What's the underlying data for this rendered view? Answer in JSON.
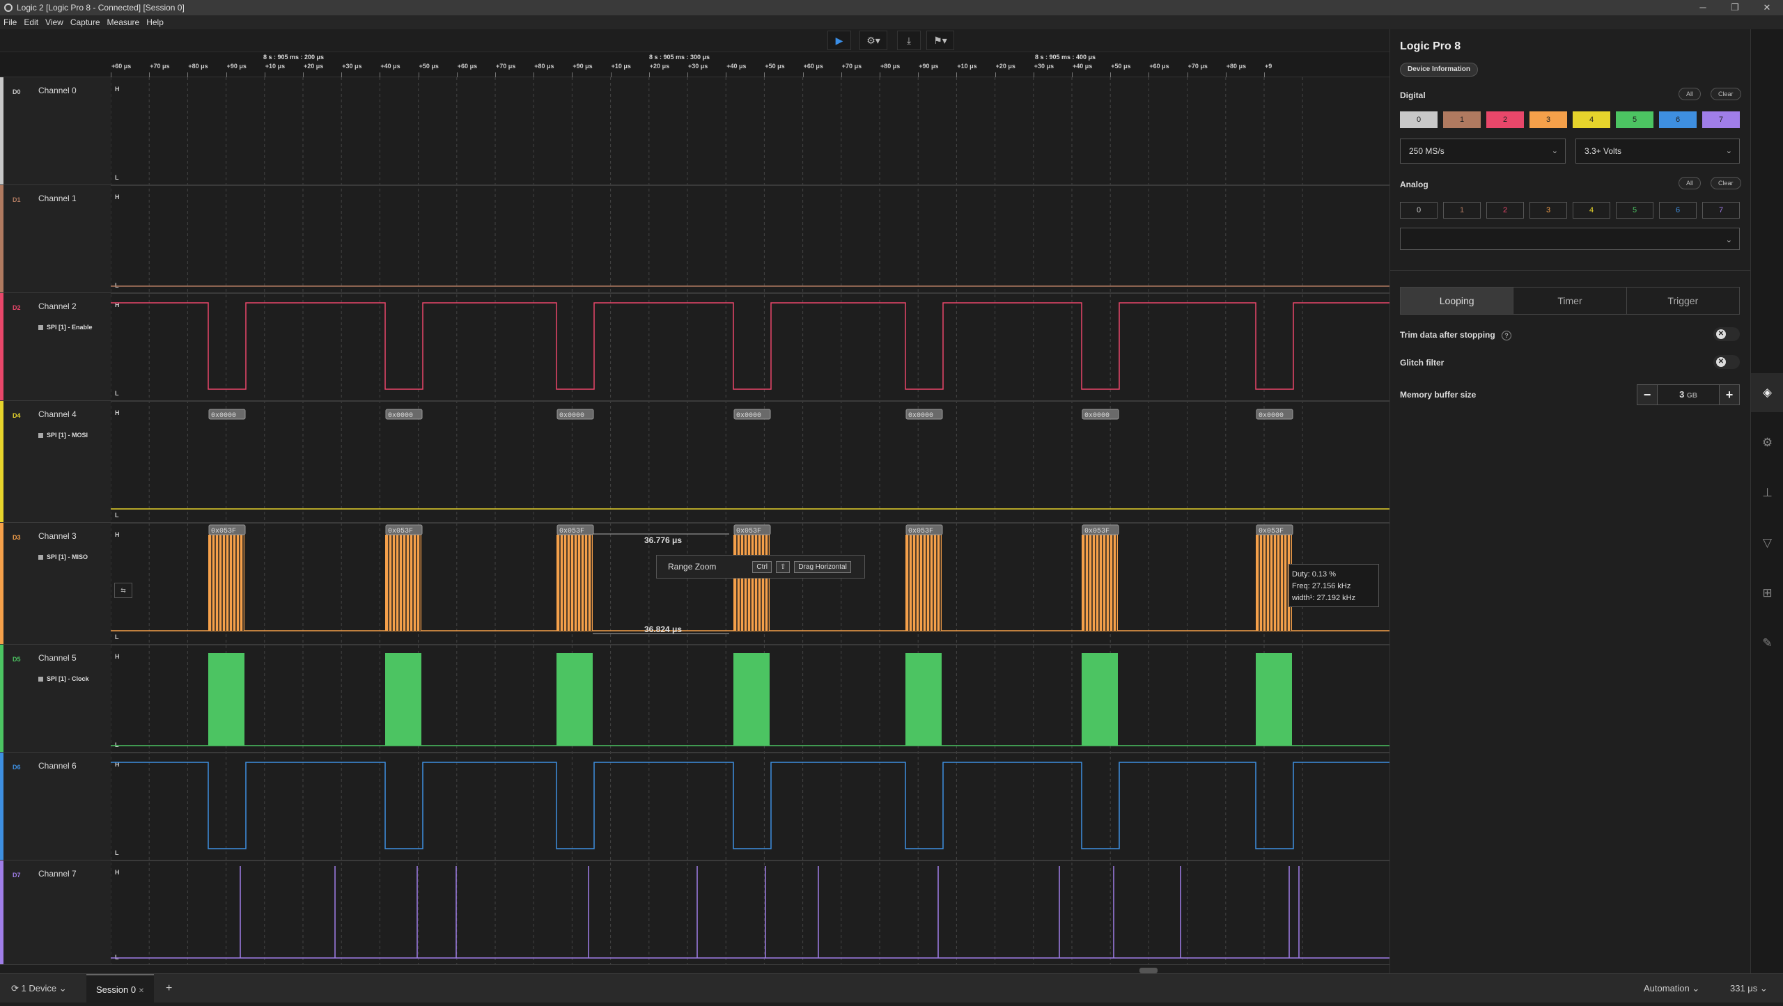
{
  "window": {
    "title": "Logic 2 [Logic Pro 8 - Connected] [Session 0]"
  },
  "menu": [
    "File",
    "Edit",
    "View",
    "Capture",
    "Measure",
    "Help"
  ],
  "ruler": {
    "markers": [
      "8 s : 905 ms : 200 μs",
      "8 s : 905 ms : 300 μs",
      "8 s : 905 ms : 400 μs"
    ],
    "ticks": [
      "+60 μs",
      "+70 μs",
      "+80 μs",
      "+90 μs",
      "+10 μs",
      "+20 μs",
      "+30 μs",
      "+40 μs",
      "+50 μs",
      "+60 μs",
      "+70 μs",
      "+80 μs",
      "+90 μs",
      "+10 μs",
      "+20 μs",
      "+30 μs",
      "+40 μs",
      "+50 μs",
      "+60 μs",
      "+70 μs",
      "+80 μs",
      "+90 μs",
      "+10 μs",
      "+20 μs",
      "+30 μs",
      "+40 μs",
      "+50 μs",
      "+60 μs",
      "+70 μs",
      "+80 μs",
      "+9"
    ]
  },
  "channels": [
    {
      "id": "D0",
      "name": "Channel 0",
      "color": "#c8c8c8",
      "protocol": ""
    },
    {
      "id": "D1",
      "name": "Channel 1",
      "color": "#b07a60",
      "protocol": ""
    },
    {
      "id": "D2",
      "name": "Channel 2",
      "color": "#e8476a",
      "protocol": "SPI [1] - Enable"
    },
    {
      "id": "D4",
      "name": "Channel 4",
      "color": "#e6d42c",
      "protocol": "SPI [1] - MOSI"
    },
    {
      "id": "D3",
      "name": "Channel 3",
      "color": "#f5a04a",
      "protocol": "SPI [1] - MISO"
    },
    {
      "id": "D5",
      "name": "Channel 5",
      "color": "#4cc462",
      "protocol": "SPI [1] - Clock"
    },
    {
      "id": "D6",
      "name": "Channel 6",
      "color": "#3e8fe0",
      "protocol": ""
    },
    {
      "id": "D7",
      "name": "Channel 7",
      "color": "#a07ee8",
      "protocol": ""
    }
  ],
  "wave_labels": {
    "high": "H",
    "low": "L"
  },
  "decoded": {
    "mosi_value": "0x0000",
    "miso_value": "0x053F"
  },
  "measurements": {
    "upper": "36.776 μs",
    "lower": "36.824 μs"
  },
  "tooltip": {
    "label": "Range Zoom",
    "key1": "Ctrl",
    "key2": "⇧",
    "action": "Drag Horizontal"
  },
  "measure_box": {
    "duty": "Duty: 0.13 %",
    "freq": "Freq: 27.156 kHz",
    "width": "width¹: 27.192 kHz"
  },
  "panel": {
    "title": "Logic Pro 8",
    "device_info": "Device Information",
    "digital_label": "Digital",
    "analog_label": "Analog",
    "all": "All",
    "clear": "Clear",
    "digital_channels": [
      "0",
      "1",
      "2",
      "3",
      "4",
      "5",
      "6",
      "7"
    ],
    "analog_channels": [
      "0",
      "1",
      "2",
      "3",
      "4",
      "5",
      "6",
      "7"
    ],
    "sample_rate": "250 MS/s",
    "voltage": "3.3+ Volts",
    "analog_rate": "",
    "tabs": [
      "Looping",
      "Timer",
      "Trigger"
    ],
    "trim_label": "Trim data after stopping",
    "glitch_label": "Glitch filter",
    "memory_label": "Memory buffer size",
    "memory_value": "3",
    "memory_unit": "GB"
  },
  "statusbar": {
    "device": "1 Device",
    "session": "Session 0",
    "add": "+",
    "automation": "Automation",
    "time": "331 μs"
  },
  "colors": {
    "accent": "#3a8ee6",
    "bg": "#1e1e1e"
  }
}
